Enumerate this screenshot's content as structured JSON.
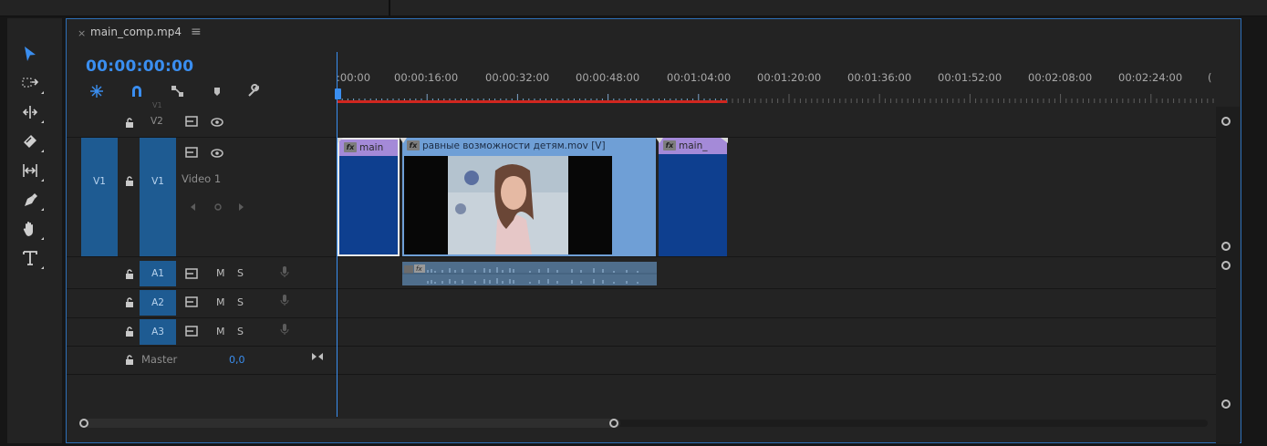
{
  "sequence": {
    "tab_close": "×",
    "tab_title": "main_comp.mp4",
    "tab_menu": "≡",
    "timecode": "00:00:00:00"
  },
  "ruler": {
    "labels": [
      ":00:00",
      "00:00:16:00",
      "00:00:32:00",
      "00:00:48:00",
      "00:01:04:00",
      "00:01:20:00",
      "00:01:36:00",
      "00:01:52:00",
      "00:02:08:00",
      "00:02:24:00",
      "("
    ]
  },
  "tracks": {
    "v2": {
      "label": "V2",
      "vname": "V1"
    },
    "v1": {
      "source": "V1",
      "label": "V1",
      "name": "Video 1"
    },
    "a1": {
      "label": "A1",
      "m": "M",
      "s": "S"
    },
    "a2": {
      "label": "A2",
      "m": "M",
      "s": "S"
    },
    "a3": {
      "label": "A3",
      "m": "M",
      "s": "S"
    },
    "master": {
      "label": "Master",
      "value": "0,0"
    }
  },
  "clips": {
    "fx": "fx",
    "clip1": "main",
    "clip2": "равные возможности детям.mov [V]",
    "clip3": "main_"
  },
  "colors": {
    "accent": "#3a8ef0",
    "target": "#1e5b92",
    "clip_video_blue": "#0e3f8f",
    "clip_header_purple": "#a48ad8",
    "clip_selected_light": "#6f9fd6",
    "audio_clip": "#4f6e8c",
    "work_area_bar": "#d0261f"
  },
  "icons": {
    "tools": [
      "selection-tool-icon",
      "track-select-icon",
      "ripple-edit-icon",
      "razor-tool-icon",
      "slip-tool-icon",
      "pen-tool-icon",
      "hand-tool-icon",
      "type-tool-icon"
    ],
    "timeline": [
      "nest-icon",
      "snap-magnet-icon",
      "linked-selection-icon",
      "add-marker-icon",
      "wrench-settings-icon"
    ]
  }
}
